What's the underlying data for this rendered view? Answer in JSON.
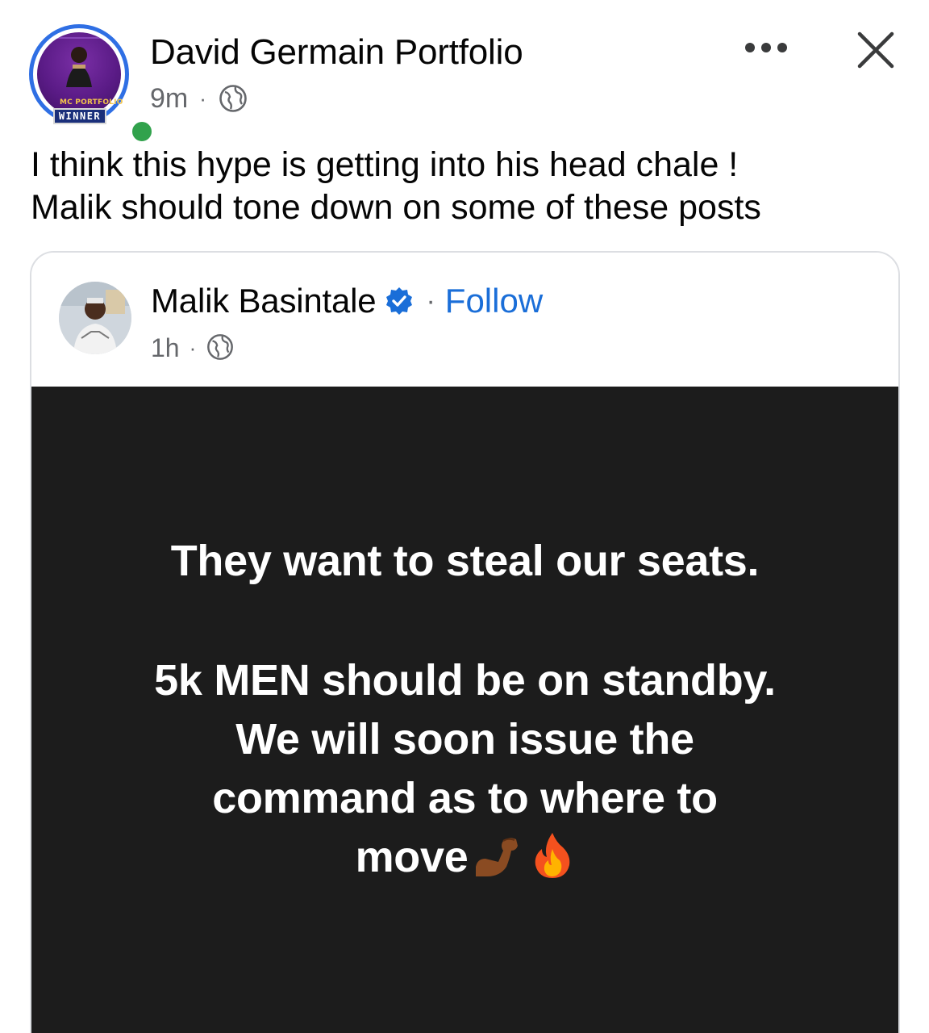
{
  "post": {
    "page_name": "David Germain Portfolio",
    "time": "9m",
    "separator": "·",
    "avatar_badge_top": "MC PORTFOLIO",
    "avatar_badge_bottom": "WINNER",
    "caption_lines": [
      "I think this hype is getting into his head chale !",
      "Malik should tone down on some of these posts"
    ],
    "icons": {
      "privacy": "globe-icon",
      "more": "more-options-icon",
      "close": "close-icon",
      "online": "online-status-dot"
    }
  },
  "shared_post": {
    "author": "Malik Basintale",
    "separator": "·",
    "follow_label": "Follow",
    "time": "1h",
    "verified_color": "#1a6ed8",
    "headline": "They want to steal our seats.",
    "body_lines": [
      "5k MEN should be on standby.",
      "We will soon issue the",
      "command as to where to",
      "move"
    ],
    "emojis": [
      "flexed-biceps-emoji",
      "fire-emoji"
    ],
    "panel_color": "#1c1c1c"
  },
  "colors": {
    "link_blue": "#1a6ed8",
    "ring_blue": "#2f6fe4",
    "online_green": "#31a24c",
    "meta_gray": "#65676b"
  }
}
